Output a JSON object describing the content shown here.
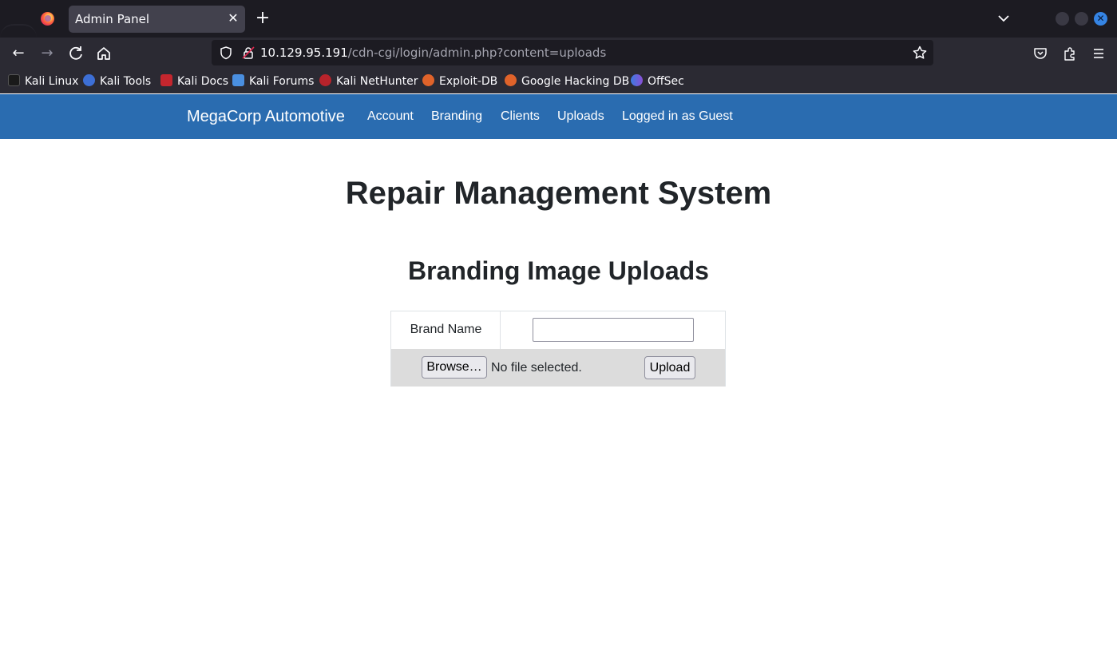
{
  "browser": {
    "tab_title": "Admin Panel",
    "url_host": "10.129.95.191",
    "url_path": "/cdn-cgi/login/admin.php?content=uploads",
    "bookmarks": [
      {
        "label": "Kali Linux",
        "icon": "kali-dragon-icon"
      },
      {
        "label": "Kali Tools",
        "icon": "kali-tools-icon"
      },
      {
        "label": "Kali Docs",
        "icon": "kali-docs-icon"
      },
      {
        "label": "Kali Forums",
        "icon": "kali-forums-icon"
      },
      {
        "label": "Kali NetHunter",
        "icon": "kali-nethunter-icon"
      },
      {
        "label": "Exploit-DB",
        "icon": "exploit-db-icon"
      },
      {
        "label": "Google Hacking DB",
        "icon": "google-hacking-db-icon"
      },
      {
        "label": "OffSec",
        "icon": "offsec-icon"
      }
    ]
  },
  "site": {
    "brand": "MegaCorp Automotive",
    "nav": [
      "Account",
      "Branding",
      "Clients",
      "Uploads",
      "Logged in as Guest"
    ],
    "accent_color": "#2a6cb0"
  },
  "main": {
    "title": "Repair Management System",
    "subtitle": "Branding Image Uploads",
    "form": {
      "brand_name_label": "Brand Name",
      "brand_name_value": "",
      "browse_label": "Browse…",
      "file_status": "No file selected.",
      "upload_label": "Upload"
    }
  }
}
